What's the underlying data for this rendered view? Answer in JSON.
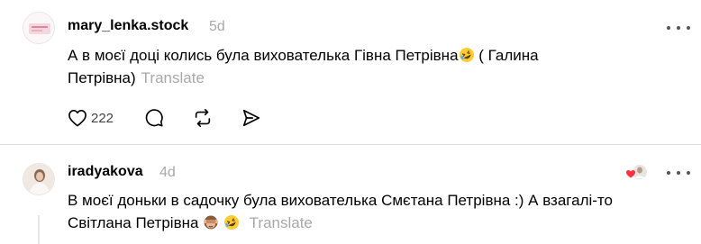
{
  "posts": [
    {
      "username": "mary_lenka.stock",
      "time": "5d",
      "text_line1": "А в моєї доці колись була вихователька Гівна Петрівна",
      "text_line1_after": " ( Галина",
      "text_line2": "Петрівна)",
      "translate": "Translate",
      "likes": "222",
      "emojis": [
        "rolling-on-floor-laughing-emoji"
      ]
    },
    {
      "username": "iradyakova",
      "time": "4d",
      "text_line1": "В моєї доньки в садочку була вихователька Смєтана Петрівна :) А взагалі-то",
      "text_line2": "Світлана Петрівна",
      "translate": "Translate",
      "emojis": [
        "see-no-evil-monkey-emoji",
        "rolling-on-floor-laughing-emoji"
      ]
    }
  ],
  "icons": {
    "like": "heart-icon",
    "reply": "comment-icon",
    "repost": "repost-icon",
    "share": "send-icon",
    "more": "more-icon"
  },
  "colors": {
    "meta_gray": "#a8a8a8",
    "like_red": "#ff3040",
    "divider": "#dcdcdc"
  }
}
